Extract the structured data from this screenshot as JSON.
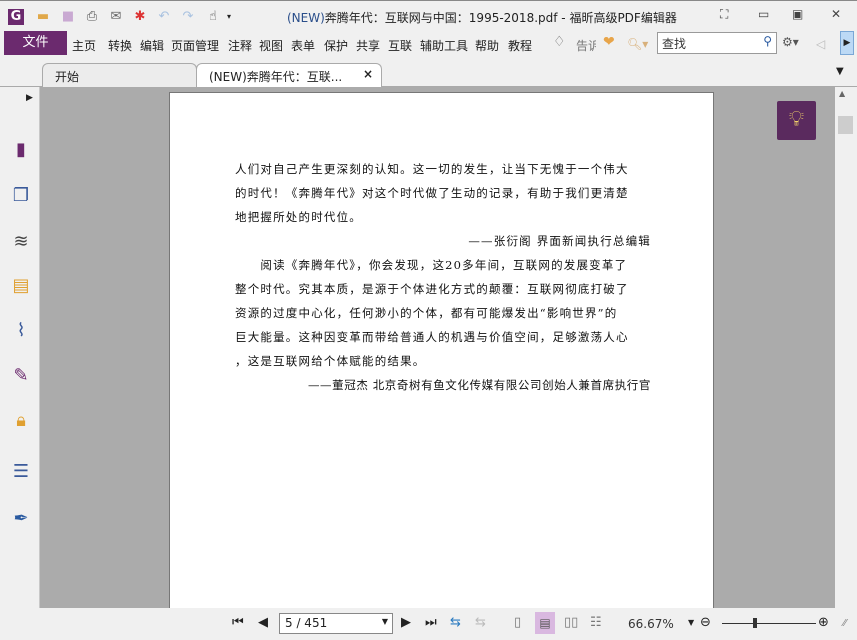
{
  "window": {
    "title_prefix": "(NEW)",
    "title_rest": "奔腾年代：互联网与中国：1995-2018.pdf - 福昕高级PDF编辑器"
  },
  "menu": {
    "file": "文件",
    "items": [
      "主页",
      "转换",
      "编辑",
      "页面管理",
      "注释",
      "视图",
      "表单",
      "保护",
      "共享",
      "互联",
      "辅助工具",
      "帮助",
      "教程"
    ],
    "tell": "告诉",
    "search_placeholder": "查找"
  },
  "tabs": [
    {
      "label": "开始"
    },
    {
      "label": "(NEW)奔腾年代：互联...",
      "close": "×"
    }
  ],
  "document": {
    "lines": [
      "人们对自己产生更深刻的认知。这一切的发生，让当下无愧于一个伟大",
      "的时代！《奔腾年代》对这个时代做了生动的记录，有助于我们更清楚",
      "地把握所处的时代位。",
      "——张衍阁 界面新闻执行总编辑",
      "　　阅读《奔腾年代》，你会发现，这20多年间，互联网的发展变革了",
      "整个时代。究其本质，是源于个体进化方式的颠覆：互联网彻底打破了",
      "资源的过度中心化，任何渺小的个体，都有可能爆发出“影响世界”的",
      "巨大能量。这种因变革而带给普通人的机遇与价值空间，足够激荡人心",
      "，这是互联网给个体赋能的结果。",
      "——董冠杰 北京奇树有鱼文化传媒有限公司创始人兼首席执行官"
    ]
  },
  "status": {
    "page": "5 / 451",
    "zoom": "66.67%",
    "zoom_slider_percent": 35
  },
  "colors": {
    "accent": "#6b2a6e"
  }
}
